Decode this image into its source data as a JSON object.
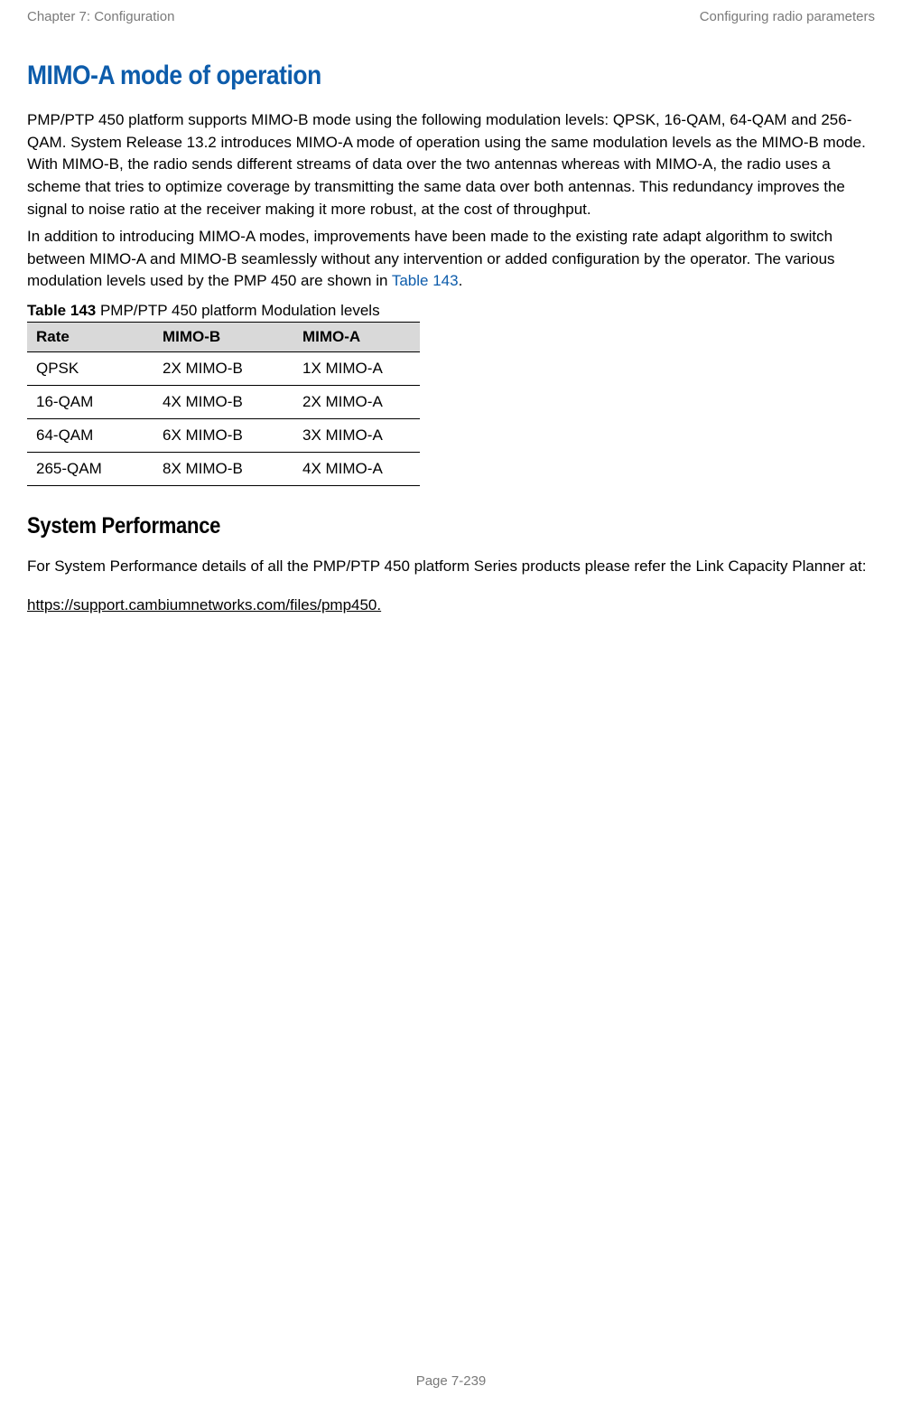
{
  "header": {
    "left": "Chapter 7:  Configuration",
    "right": "Configuring radio parameters"
  },
  "heading1": "MIMO-A mode of operation",
  "para1": "PMP/PTP 450 platform supports MIMO-B mode using the following modulation levels: QPSK, 16-QAM, 64-QAM and 256-QAM. System Release 13.2 introduces MIMO-A mode of operation using the same modulation levels as the MIMO-B mode. With MIMO-B, the radio sends different streams of data over the two antennas whereas with MIMO-A, the radio uses a scheme that tries to optimize coverage by transmitting the same data over both antennas. This redundancy improves the signal to noise ratio at the receiver making it more robust, at the cost of throughput.",
  "para2_prefix": "In addition to introducing MIMO-A modes, improvements have been made to the existing rate adapt algorithm to switch between MIMO-A and MIMO-B seamlessly without any intervention or added configuration by the operator. The various modulation levels used by the PMP 450 are shown in ",
  "para2_link": "Table 143",
  "para2_suffix": ".",
  "table_caption_bold": "Table 143",
  "table_caption_rest": " PMP/PTP 450 platform Modulation levels",
  "table": {
    "headers": [
      "Rate",
      "MIMO-B",
      "MIMO-A"
    ],
    "rows": [
      [
        "QPSK",
        "2X MIMO-B",
        "1X MIMO-A"
      ],
      [
        "16-QAM",
        "4X MIMO-B",
        "2X MIMO-A"
      ],
      [
        "64-QAM",
        "6X MIMO-B",
        "3X MIMO-A"
      ],
      [
        "265-QAM",
        "8X MIMO-B",
        "4X MIMO-A"
      ]
    ]
  },
  "heading2": "System Performance",
  "sys_para": "For System Performance details of all the PMP/PTP 450 platform Series products please refer the Link Capacity  Planner at:",
  "ext_link_text": "https://support.cambiumnetworks.com/files/pmp450.",
  "footer": "Page 7-239"
}
